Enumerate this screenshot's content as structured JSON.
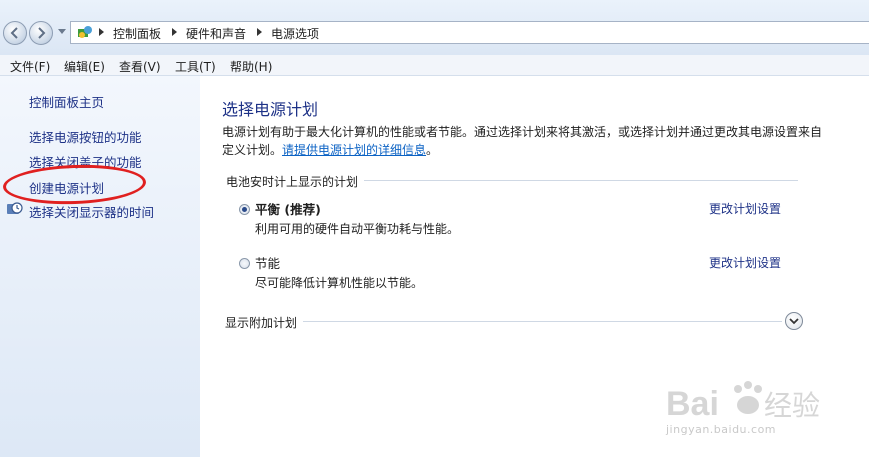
{
  "address_bar": {
    "breadcrumbs": [
      "控制面板",
      "硬件和声音",
      "电源选项"
    ],
    "icon": "control-panel-icon"
  },
  "menu": [
    "文件(F)",
    "编辑(E)",
    "查看(V)",
    "工具(T)",
    "帮助(H)"
  ],
  "sidebar": {
    "home": "控制面板主页",
    "links": [
      "选择电源按钮的功能",
      "选择关闭盖子的功能",
      "创建电源计划",
      "选择关闭显示器的时间"
    ],
    "annotation_color": "#e02020"
  },
  "main": {
    "title": "选择电源计划",
    "description": "电源计划有助于最大化计算机的性能或者节能。通过选择计划来将其激活，或选择计划并通过更改其电源设置来自定义计划。",
    "description_link": "请提供电源计划的详细信息",
    "group_header": "电池安时计上显示的计划",
    "plans": [
      {
        "name": "平衡 (推荐)",
        "desc": "利用可用的硬件自动平衡功耗与性能。",
        "link": "更改计划设置",
        "selected": true
      },
      {
        "name": "节能",
        "desc": "尽可能降低计算机性能以节能。",
        "link": "更改计划设置",
        "selected": false
      }
    ],
    "show_more": "显示附加计划"
  },
  "watermark": {
    "text": "Bai 经验",
    "url": "jingyan.baidu.com"
  },
  "colors": {
    "link": "#1e3287",
    "title": "#1e3287",
    "hyperlink": "#0b62c4"
  }
}
